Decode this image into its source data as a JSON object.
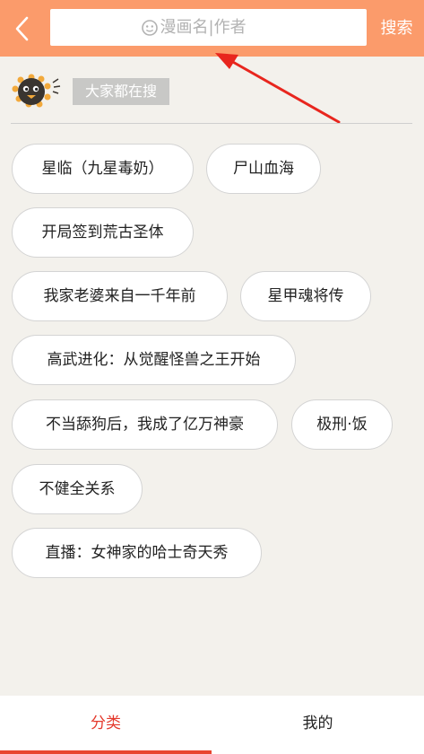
{
  "header": {
    "search_placeholder": "漫画名|作者",
    "search_button": "搜索"
  },
  "hot_section": {
    "label": "大家都在搜"
  },
  "tags": [
    "星临（九星毒奶）",
    "尸山血海",
    "开局签到荒古圣体",
    "我家老婆来自一千年前",
    "星甲魂将传",
    "高武进化：从觉醒怪兽之王开始",
    "不当舔狗后，我成了亿万神豪",
    "极刑·饭",
    "不健全关系",
    "直播：女神家的哈士奇天秀"
  ],
  "tabbar": {
    "tabs": [
      "分类",
      "我的"
    ],
    "active_index": 0
  },
  "colors": {
    "header": "#fb9b6b",
    "accent": "#e4392c",
    "background": "#f3f1ec"
  },
  "icons": [
    "back-arrow-icon",
    "search-icon",
    "mascot-icon",
    "annotation-arrow"
  ]
}
